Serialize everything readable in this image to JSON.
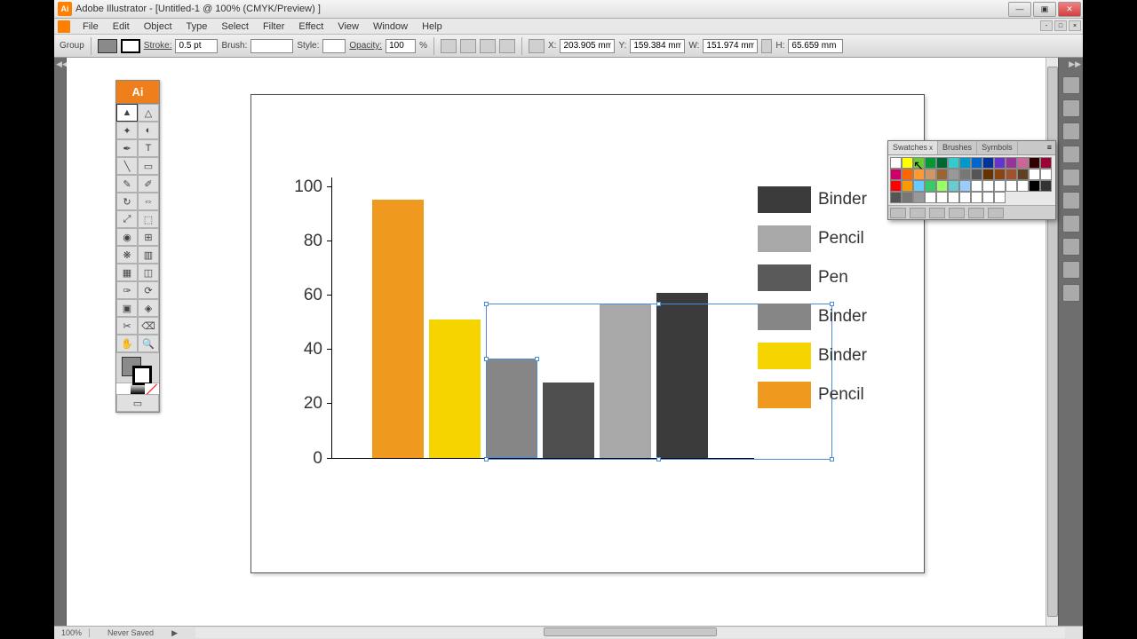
{
  "titlebar": {
    "icon": "Ai",
    "text": "Adobe Illustrator - [Untitled-1 @ 100% (CMYK/Preview) ]"
  },
  "menu": {
    "items": [
      "File",
      "Edit",
      "Object",
      "Type",
      "Select",
      "Filter",
      "Effect",
      "View",
      "Window",
      "Help"
    ]
  },
  "optionsbar": {
    "selection": "Group",
    "stroke_label": "Stroke:",
    "stroke_val": "0.5 pt",
    "brush_label": "Brush:",
    "style_label": "Style:",
    "opacity_label": "Opacity:",
    "opacity_val": "100",
    "opacity_unit": "%",
    "x_label": "X:",
    "x_val": "203.905 mm",
    "y_label": "Y:",
    "y_val": "159.384 mm",
    "w_label": "W:",
    "w_val": "151.974 mm",
    "h_label": "H:",
    "h_val": "65.659 mm"
  },
  "toolbox": {
    "header": "Ai"
  },
  "chart_data": {
    "type": "bar",
    "categories": [
      "",
      "",
      "",
      "",
      "",
      ""
    ],
    "values": [
      95,
      50,
      36,
      27,
      56,
      60
    ],
    "colors": [
      "#ef9a1f",
      "#f5d400",
      "#868686",
      "#4e4e4e",
      "#a8a8a8",
      "#3b3b3b"
    ],
    "ylabel": "",
    "ylim": [
      0,
      100
    ],
    "yticks": [
      0,
      20,
      40,
      60,
      80,
      100
    ],
    "legend": [
      {
        "label": "Binder",
        "color": "#3b3b3b"
      },
      {
        "label": "Pencil",
        "color": "#a8a8a8"
      },
      {
        "label": "Pen",
        "color": "#5a5a5a"
      },
      {
        "label": "Binder",
        "color": "#868686"
      },
      {
        "label": "Binder",
        "color": "#f5d400"
      },
      {
        "label": "Pencil",
        "color": "#ef9a1f"
      }
    ]
  },
  "swatches": {
    "tabs": [
      "Swatches",
      "Brushes",
      "Symbols"
    ],
    "close_x": "x",
    "colors_row1": [
      "#ffffff",
      "#ffff00",
      "#66cc33",
      "#009933",
      "#006633",
      "#33cccc",
      "#0099cc",
      "#0066cc",
      "#003399",
      "#6633cc",
      "#993399",
      "#cc6699",
      "#330000"
    ],
    "colors_row2": [
      "#990033",
      "#cc0066",
      "#ff6600",
      "#ff9933",
      "#cc9966",
      "#996633",
      "#999999",
      "#777777",
      "#555555",
      "#663300",
      "#8b4513",
      "#a0522d",
      "#604020"
    ],
    "colors_row3": [
      "#ffffff",
      "#ffffff",
      "#ff0000",
      "#ff9900",
      "#66ccff",
      "#33cc66",
      "#99ff66",
      "#66cccc",
      "#99ccff",
      "#ffffff",
      "#ffffff",
      "#ffffff",
      "#ffffff"
    ],
    "colors_row4": [
      "#ffffff",
      "#000000",
      "#333333",
      "#555555",
      "#777777",
      "#999999",
      "#ffffff",
      "#ffffff",
      "#ffffff",
      "#ffffff",
      "#ffffff",
      "#ffffff",
      "#ffffff"
    ]
  },
  "statusbar": {
    "zoom": "100%",
    "saved": "Never Saved"
  }
}
